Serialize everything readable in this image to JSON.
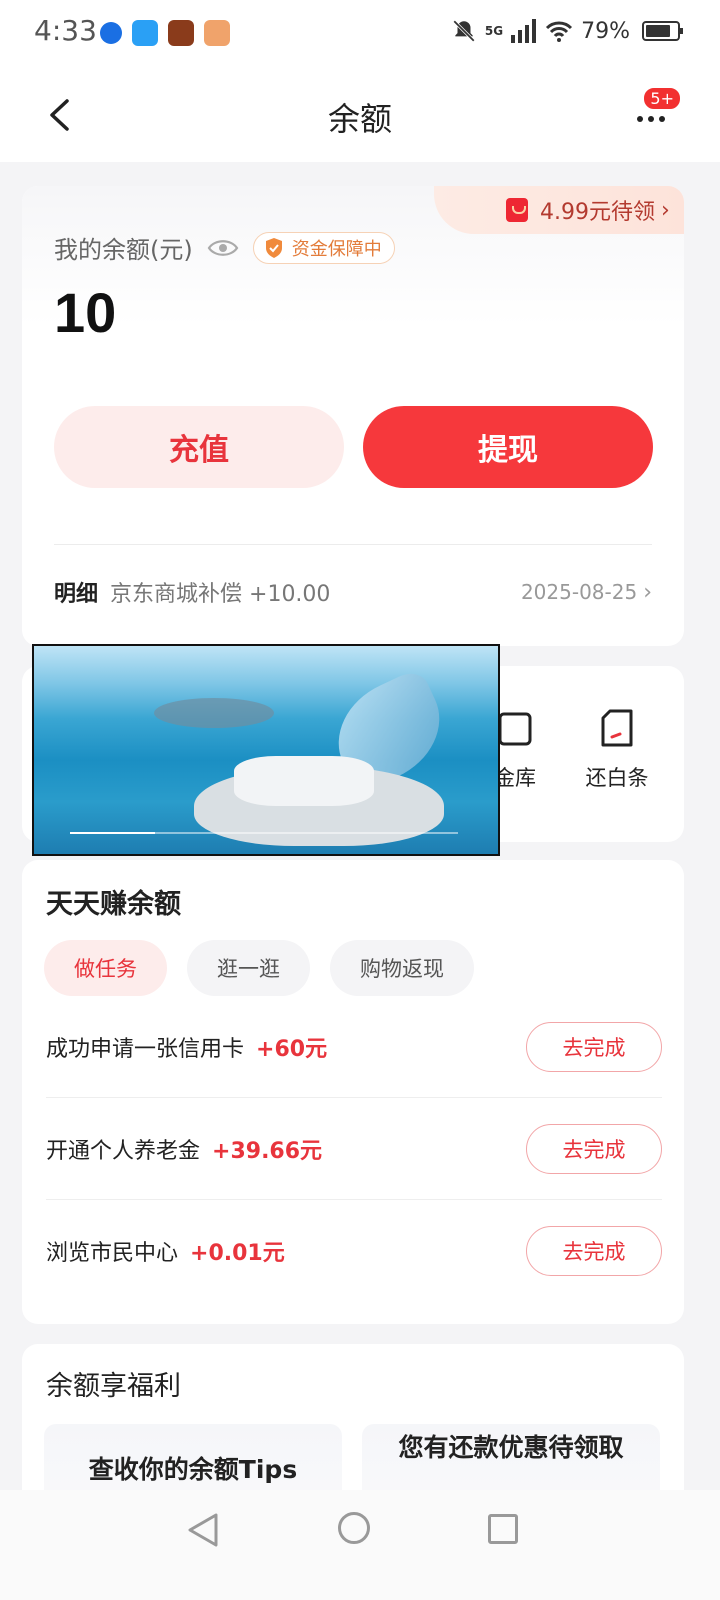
{
  "status_bar": {
    "time": "4:33",
    "network": "5G",
    "battery": "79%",
    "battery_level": 0.79
  },
  "header": {
    "title": "余额",
    "notification_badge": "5+"
  },
  "balance": {
    "redpack_text": "4.99元待领",
    "label": "我的余额(元)",
    "safe_badge": "资金保障中",
    "amount": "10",
    "recharge_label": "充值",
    "withdraw_label": "提现",
    "detail_label": "明细",
    "detail_desc": "京东商城补偿 +10.00",
    "detail_date": "2025-08-25"
  },
  "services": [
    {
      "label": "金库",
      "icon": "vault-icon"
    },
    {
      "label": "还白条",
      "icon": "repay-icon"
    }
  ],
  "earn": {
    "title": "天天赚余额",
    "tabs": [
      {
        "label": "做任务",
        "active": true
      },
      {
        "label": "逛一逛",
        "active": false
      },
      {
        "label": "购物返现",
        "active": false
      }
    ],
    "tasks": [
      {
        "name": "成功申请一张信用卡",
        "reward": "+60元",
        "button": "去完成"
      },
      {
        "name": "开通个人养老金",
        "reward": "+39.66元",
        "button": "去完成"
      },
      {
        "name": "浏览市民中心",
        "reward": "+0.01元",
        "button": "去完成"
      }
    ]
  },
  "benefits": {
    "title": "余额享福利",
    "tiles": [
      {
        "text": "查收你的余额Tips"
      },
      {
        "text": "您有还款优惠待领取"
      }
    ]
  },
  "colors": {
    "accent": "#f6383c",
    "accent_light": "#fdeceb",
    "background": "#f4f4f6"
  },
  "video_overlay": {
    "progress": 0.22
  }
}
